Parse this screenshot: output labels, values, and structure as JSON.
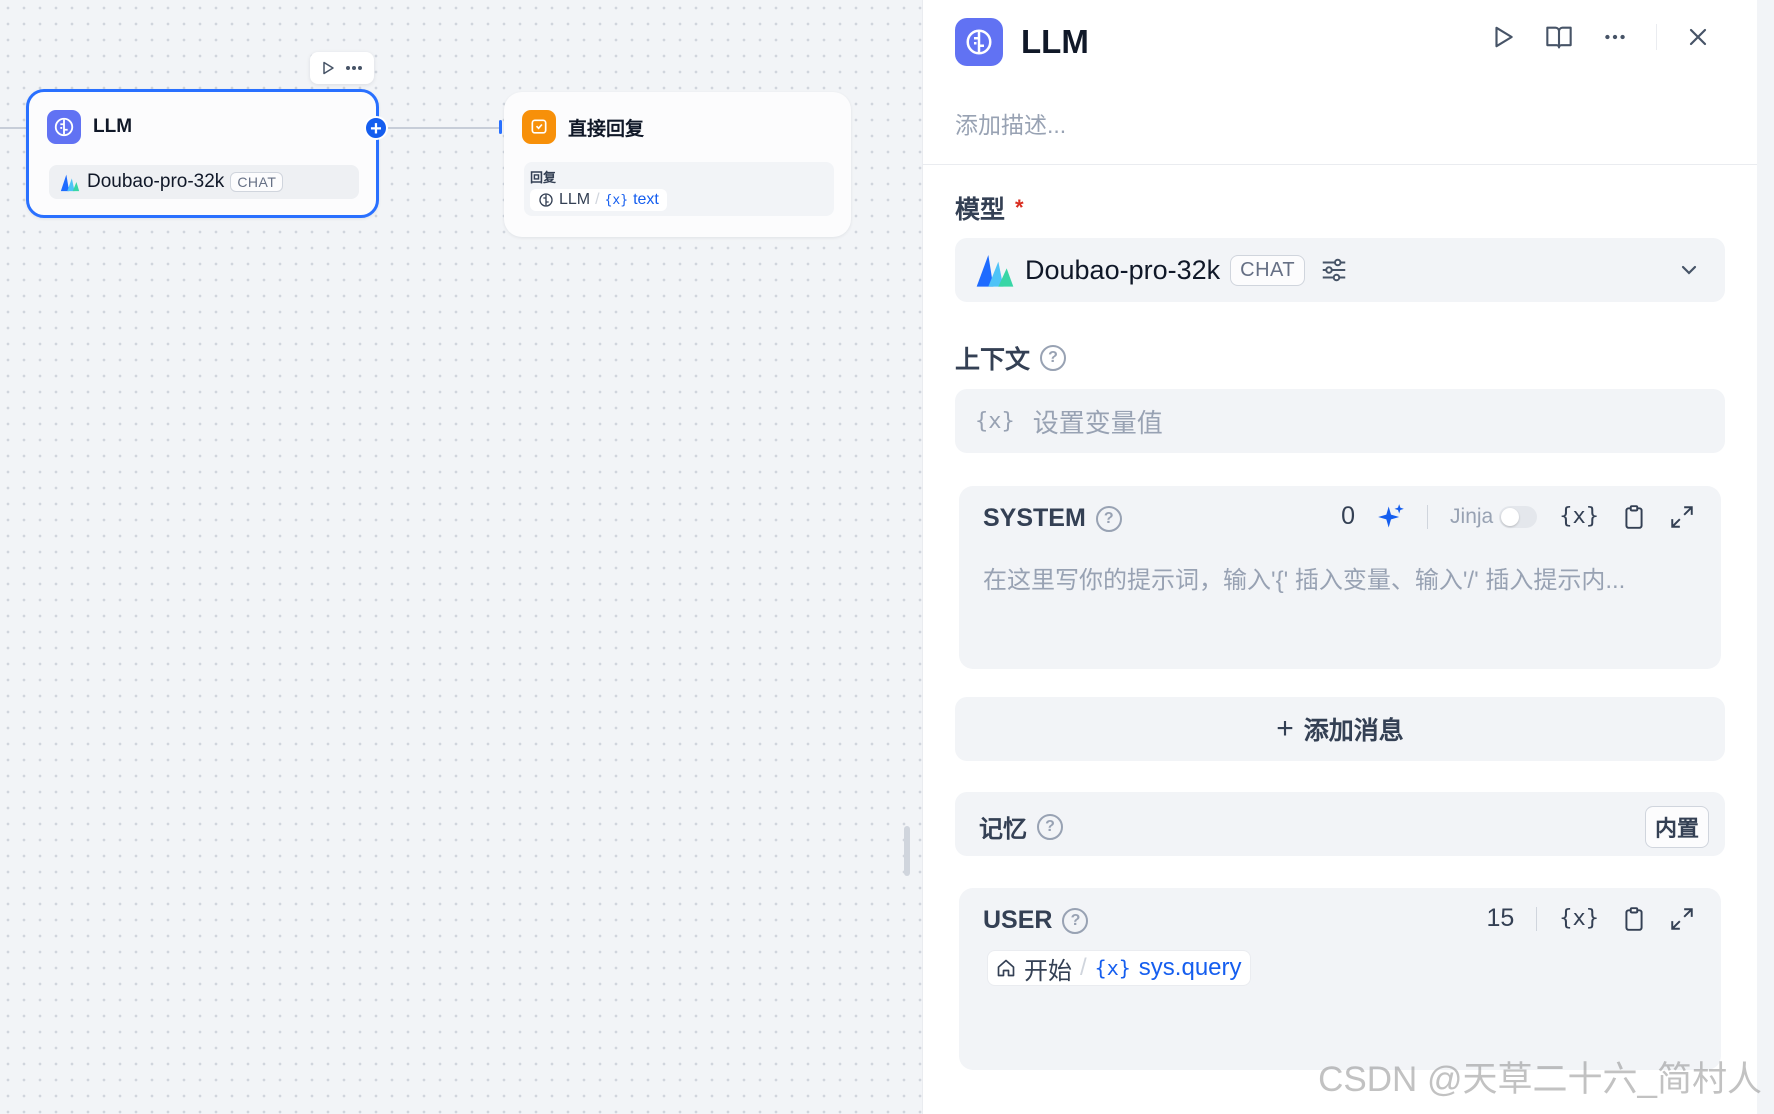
{
  "canvas": {
    "llm_node": {
      "title": "LLM",
      "model": "Doubao-pro-32k",
      "mode": "CHAT"
    },
    "reply_node": {
      "title": "直接回复",
      "section_label": "回复",
      "source_node": "LLM",
      "variable": "text"
    }
  },
  "panel": {
    "title": "LLM",
    "description_placeholder": "添加描述...",
    "model": {
      "label": "模型",
      "required_mark": "*",
      "name": "Doubao-pro-32k",
      "mode": "CHAT"
    },
    "context": {
      "label": "上下文",
      "placeholder": "设置变量值"
    },
    "system": {
      "label": "SYSTEM",
      "count": "0",
      "jinja_label": "Jinja",
      "placeholder": "在这里写你的提示词，输入'{' 插入变量、输入'/' 插入提示内..."
    },
    "add_message": "添加消息",
    "memory": {
      "label": "记忆",
      "badge": "内置"
    },
    "user": {
      "label": "USER",
      "count": "15",
      "chip_node": "开始",
      "chip_variable": "sys.query"
    }
  },
  "watermark": "CSDN @天草二十六_简村人",
  "colors": {
    "accent": "#155eef",
    "llm_icon": "#6172f3",
    "reply_icon": "#f79009"
  }
}
